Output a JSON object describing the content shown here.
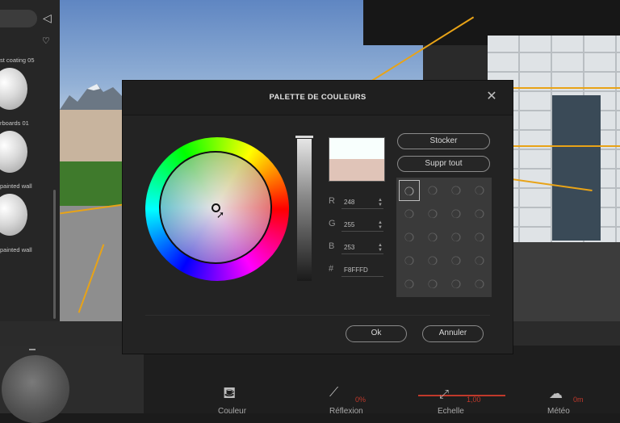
{
  "dialog": {
    "title": "PALETTE DE COULEURS",
    "close_icon": "close-icon",
    "store_label": "Stocker",
    "clear_all_label": "Suppr  tout",
    "ok_label": "Ok",
    "cancel_label": "Annuler",
    "new_color": "#F8FFFD",
    "previous_color": "#E0C4B8",
    "fields": {
      "r_label": "R",
      "r_value": "248",
      "g_label": "G",
      "g_value": "255",
      "b_label": "B",
      "b_value": "253",
      "hex_label": "#",
      "hex_value": "F8FFFD"
    },
    "swatch_slots": 20,
    "swatch_icon": "paint-drop-icon"
  },
  "left_panel": {
    "materials": [
      {
        "label": "st coating 05"
      },
      {
        "label": "rboards 01"
      },
      {
        "label": "painted wall"
      },
      {
        "label": "painted wall"
      }
    ],
    "icons": [
      "back-icon",
      "heart-icon"
    ]
  },
  "bottom_bar": {
    "items": [
      {
        "label": "Couleur",
        "icon": "paint-bucket-icon"
      },
      {
        "label": "Réflexion",
        "value": "0%",
        "icon": "reflection-icon"
      },
      {
        "label": "Echelle",
        "value": "1,00",
        "icon": "scale-icon"
      },
      {
        "label": "Météo",
        "value": "0m",
        "icon": "weather-icon"
      }
    ]
  }
}
